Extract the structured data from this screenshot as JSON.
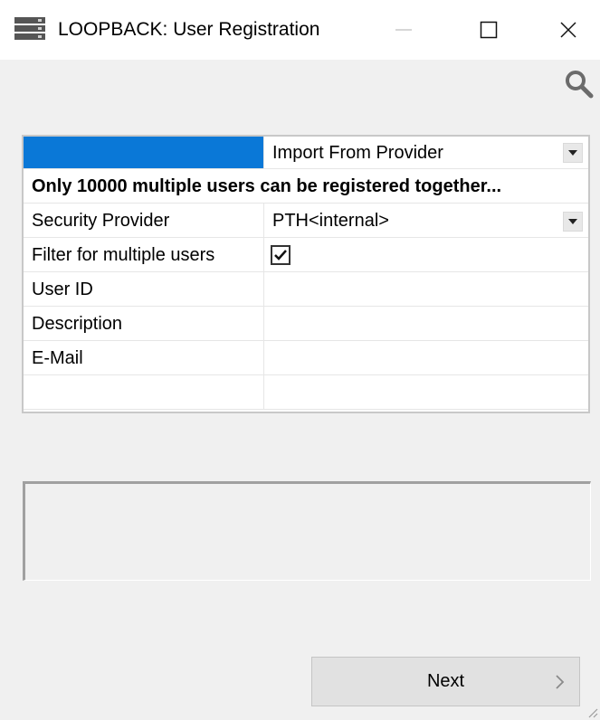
{
  "window": {
    "title": "LOOPBACK: User Registration",
    "icons": {
      "app": "server-stack-icon",
      "minimize": "minimize-icon",
      "maximize": "maximize-icon",
      "close": "close-icon",
      "search": "search-icon"
    }
  },
  "grid": {
    "header": {
      "label": "",
      "value": "Import From Provider"
    },
    "notice": "Only 10000 multiple users can be registered together...",
    "rows": [
      {
        "label": "Security Provider",
        "value": "PTH<internal>"
      },
      {
        "label": "Filter for multiple users",
        "value": "",
        "checked": true
      },
      {
        "label": "User ID",
        "value": ""
      },
      {
        "label": "Description",
        "value": ""
      },
      {
        "label": "E-Mail",
        "value": ""
      },
      {
        "label": "",
        "value": ""
      }
    ]
  },
  "message": {
    "text": ""
  },
  "footer": {
    "next_label": "Next",
    "next_icon": "chevron-right-icon"
  },
  "colors": {
    "selection": "#0a78d7",
    "window_bg": "#f0f0f0"
  }
}
